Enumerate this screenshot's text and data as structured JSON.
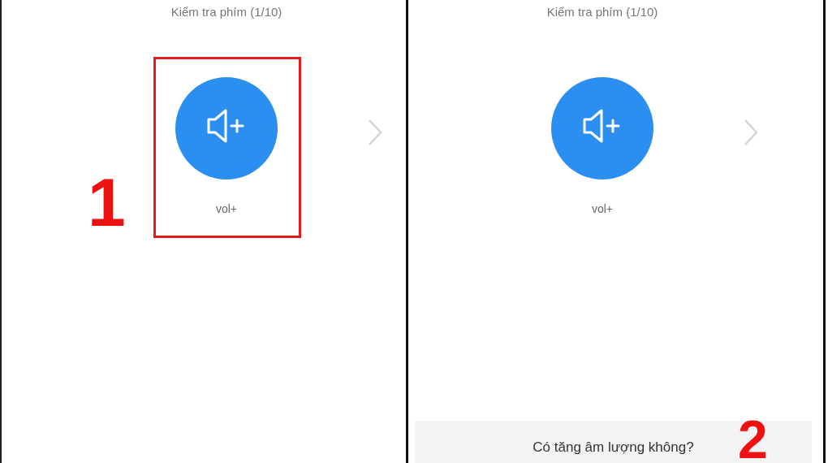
{
  "panels": [
    {
      "title": "Kiểm tra phím (1/10)",
      "key_label": "vol+",
      "highlighted": true,
      "step": "1"
    },
    {
      "title": "Kiểm tra phím (1/10)",
      "key_label": "vol+",
      "highlighted": false,
      "step": "2",
      "prompt": "Có tăng âm lượng không?"
    }
  ]
}
